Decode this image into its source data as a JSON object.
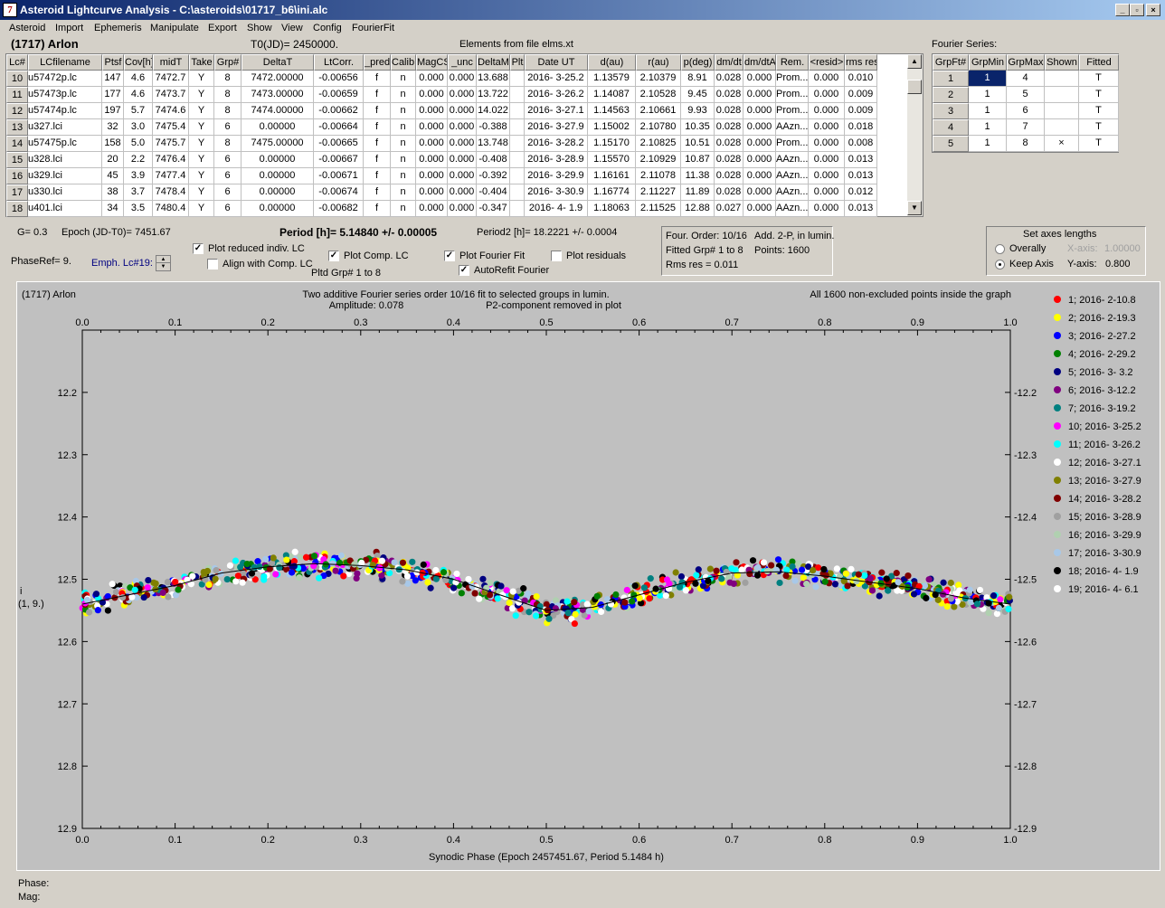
{
  "window": {
    "title": "Asteroid Lightcurve Analysis - C:\\asteroids\\01717_b6\\ini.alc",
    "icon_glyph": "7",
    "min": "_",
    "restore": "▫",
    "close": "×"
  },
  "menu": [
    "Asteroid",
    "Import",
    "Ephemeris",
    "Manipulate",
    "Export",
    "Show",
    "View",
    "Config",
    "FourierFit"
  ],
  "header": {
    "asteroid": "(1717) Arlon",
    "t0": "T0(JD)= 2450000.",
    "elements": "Elements from file elms.xt",
    "fourier_label": "Fourier Series:"
  },
  "lc_table": {
    "columns": [
      "Lc#",
      "LCfilename",
      "Ptsf",
      "Cov[h]",
      "midT",
      "Take",
      "Grp#",
      "DeltaT",
      "LtCorr.",
      "_pred",
      "Calib.",
      "MagCS",
      "_unc",
      "DeltaM",
      "Plt",
      "Date UT",
      "d(au)",
      "r(au)",
      "p(deg)",
      "dm/dt",
      "dm/dtA",
      "Rem.",
      "<resid>",
      "rms res"
    ],
    "rows": [
      [
        "10",
        "u57472p.lc",
        "147",
        "4.6",
        "7472.7",
        "Y",
        "8",
        "7472.00000",
        "-0.00656",
        "f",
        "n",
        "0.000",
        "0.000",
        "13.688",
        "",
        "2016- 3-25.2",
        "1.13579",
        "2.10379",
        "8.91",
        "0.028",
        "0.000",
        "Prom...",
        "0.000",
        "0.010"
      ],
      [
        "11",
        "u57473p.lc",
        "177",
        "4.6",
        "7473.7",
        "Y",
        "8",
        "7473.00000",
        "-0.00659",
        "f",
        "n",
        "0.000",
        "0.000",
        "13.722",
        "",
        "2016- 3-26.2",
        "1.14087",
        "2.10528",
        "9.45",
        "0.028",
        "0.000",
        "Prom...",
        "0.000",
        "0.009"
      ],
      [
        "12",
        "u57474p.lc",
        "197",
        "5.7",
        "7474.6",
        "Y",
        "8",
        "7474.00000",
        "-0.00662",
        "f",
        "n",
        "0.000",
        "0.000",
        "14.022",
        "",
        "2016- 3-27.1",
        "1.14563",
        "2.10661",
        "9.93",
        "0.028",
        "0.000",
        "Prom...",
        "0.000",
        "0.009"
      ],
      [
        "13",
        "u327.lci",
        "32",
        "3.0",
        "7475.4",
        "Y",
        "6",
        "0.00000",
        "-0.00664",
        "f",
        "n",
        "0.000",
        "0.000",
        "-0.388",
        "",
        "2016- 3-27.9",
        "1.15002",
        "2.10780",
        "10.35",
        "0.028",
        "0.000",
        "AAzn...",
        "0.000",
        "0.018"
      ],
      [
        "14",
        "u57475p.lc",
        "158",
        "5.0",
        "7475.7",
        "Y",
        "8",
        "7475.00000",
        "-0.00665",
        "f",
        "n",
        "0.000",
        "0.000",
        "13.748",
        "",
        "2016- 3-28.2",
        "1.15170",
        "2.10825",
        "10.51",
        "0.028",
        "0.000",
        "Prom...",
        "0.000",
        "0.008"
      ],
      [
        "15",
        "u328.lci",
        "20",
        "2.2",
        "7476.4",
        "Y",
        "6",
        "0.00000",
        "-0.00667",
        "f",
        "n",
        "0.000",
        "0.000",
        "-0.408",
        "",
        "2016- 3-28.9",
        "1.15570",
        "2.10929",
        "10.87",
        "0.028",
        "0.000",
        "AAzn...",
        "0.000",
        "0.013"
      ],
      [
        "16",
        "u329.lci",
        "45",
        "3.9",
        "7477.4",
        "Y",
        "6",
        "0.00000",
        "-0.00671",
        "f",
        "n",
        "0.000",
        "0.000",
        "-0.392",
        "",
        "2016- 3-29.9",
        "1.16161",
        "2.11078",
        "11.38",
        "0.028",
        "0.000",
        "AAzn...",
        "0.000",
        "0.013"
      ],
      [
        "17",
        "u330.lci",
        "38",
        "3.7",
        "7478.4",
        "Y",
        "6",
        "0.00000",
        "-0.00674",
        "f",
        "n",
        "0.000",
        "0.000",
        "-0.404",
        "",
        "2016- 3-30.9",
        "1.16774",
        "2.11227",
        "11.89",
        "0.028",
        "0.000",
        "AAzn...",
        "0.000",
        "0.012"
      ],
      [
        "18",
        "u401.lci",
        "34",
        "3.5",
        "7480.4",
        "Y",
        "6",
        "0.00000",
        "-0.00682",
        "f",
        "n",
        "0.000",
        "0.000",
        "-0.347",
        "",
        "2016- 4- 1.9",
        "1.18063",
        "2.11525",
        "12.88",
        "0.027",
        "0.000",
        "AAzn...",
        "0.000",
        "0.013"
      ]
    ]
  },
  "fourier_table": {
    "columns": [
      "GrpFt#",
      "GrpMin",
      "GrpMax",
      "Shown",
      "Fitted"
    ],
    "rows": [
      [
        "1",
        "1",
        "4",
        "",
        "T"
      ],
      [
        "2",
        "1",
        "5",
        "",
        "T"
      ],
      [
        "3",
        "1",
        "6",
        "",
        "T"
      ],
      [
        "4",
        "1",
        "7",
        "",
        "T"
      ],
      [
        "5",
        "1",
        "8",
        "×",
        "T"
      ]
    ]
  },
  "params": {
    "g": "G= 0.3",
    "epoch": "Epoch (JD-T0)= 7451.67",
    "period": "Period [h]= 5.14840 +/- 0.00005",
    "period2": "Period2 [h]= 18.2221 +/- 0.0004",
    "phaseref": "PhaseRef= 9.",
    "emph": "Emph. Lc#19:",
    "plot_reduced": "Plot reduced indiv. LC",
    "align": "Align with Comp. LC",
    "plot_comp": "Plot Comp. LC",
    "pltd_grp": "Pltd Grp#  1   to    8",
    "plot_fourier": "Plot Fourier Fit",
    "autorefit": "AutoRefit Fourier",
    "plot_resid": "Plot residuals",
    "four_order": "Four. Order: 10/16",
    "add": "Add. 2-P, in lumin.",
    "fitted_grp": "Fitted Grp# 1 to 8",
    "points": "Points: 1600",
    "rms": "Rms res     = 0.011",
    "axes_title": "Set axes lengths",
    "overally": "Overally",
    "keep_axis": "Keep Axis",
    "xaxis_lbl": "X-axis:",
    "xaxis_val": "1.00000",
    "yaxis_lbl": "Y-axis:",
    "yaxis_val": "0.800"
  },
  "plot": {
    "name": "(1717) Arlon",
    "title1": "Two additive Fourier series order 10/16 fit to selected groups in lumin.",
    "title2": "Amplitude: 0.078",
    "title3": "P2-component removed in plot",
    "right_note": "All 1600 non-excluded points inside the graph",
    "ylabel1": "i",
    "ylabel2": "(1, 9.)",
    "xlabel": "Synodic Phase (Epoch 2457451.67, Period 5.1484 h)"
  },
  "chart_data": {
    "type": "scatter",
    "xlim": [
      0.0,
      1.0
    ],
    "ylim": [
      12.9,
      12.1
    ],
    "y_inverted": true,
    "xticks": [
      "0.0",
      "0.1",
      "0.2",
      "0.3",
      "0.4",
      "0.5",
      "0.6",
      "0.7",
      "0.8",
      "0.9",
      "1.0"
    ],
    "yticks": [
      "12.2",
      "12.3",
      "12.4",
      "12.5",
      "12.6",
      "12.7",
      "12.8",
      "12.9"
    ],
    "fit_curve": {
      "x": [
        0.0,
        0.05,
        0.1,
        0.15,
        0.2,
        0.25,
        0.3,
        0.35,
        0.4,
        0.45,
        0.5,
        0.55,
        0.6,
        0.65,
        0.7,
        0.75,
        0.8,
        0.85,
        0.9,
        0.95,
        1.0
      ],
      "y": [
        12.54,
        12.525,
        12.51,
        12.49,
        12.48,
        12.475,
        12.478,
        12.485,
        12.5,
        12.525,
        12.55,
        12.545,
        12.525,
        12.505,
        12.49,
        12.488,
        12.495,
        12.505,
        12.515,
        12.53,
        12.54
      ]
    },
    "legend": [
      {
        "name": "1; 2016- 2-10.8",
        "color": "#ff0000"
      },
      {
        "name": "2; 2016- 2-19.3",
        "color": "#ffff00"
      },
      {
        "name": "3; 2016- 2-27.2",
        "color": "#0000ff"
      },
      {
        "name": "4; 2016- 2-29.2",
        "color": "#008000"
      },
      {
        "name": "5; 2016- 3- 3.2",
        "color": "#000080"
      },
      {
        "name": "6; 2016- 3-12.2",
        "color": "#800080"
      },
      {
        "name": "7; 2016- 3-19.2",
        "color": "#008080"
      },
      {
        "name": "10; 2016- 3-25.2",
        "color": "#ff00ff"
      },
      {
        "name": "11; 2016- 3-26.2",
        "color": "#00ffff"
      },
      {
        "name": "12; 2016- 3-27.1",
        "color": "#ffffff"
      },
      {
        "name": "13; 2016- 3-27.9",
        "color": "#808000"
      },
      {
        "name": "14; 2016- 3-28.2",
        "color": "#800000"
      },
      {
        "name": "15; 2016- 3-28.9",
        "color": "#a0a0a0"
      },
      {
        "name": "16; 2016- 3-29.9",
        "color": "#b0d0b0"
      },
      {
        "name": "17; 2016- 3-30.9",
        "color": "#a8c8e8"
      },
      {
        "name": "18; 2016- 4- 1.9",
        "color": "#000000"
      },
      {
        "name": "19; 2016- 4- 6.1",
        "color": "#ffffff"
      }
    ]
  },
  "status": {
    "phase": "Phase:",
    "mag": "Mag:"
  }
}
